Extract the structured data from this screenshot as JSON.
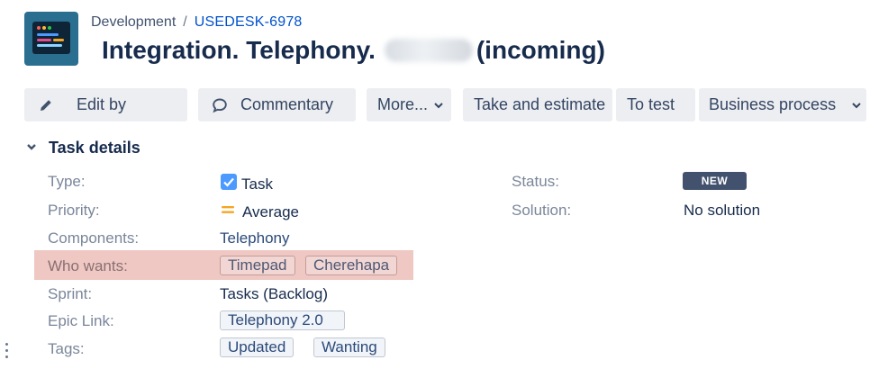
{
  "breadcrumb": {
    "project": "Development",
    "separator": "/",
    "issue_key": "USEDESK-6978"
  },
  "issue": {
    "title_prefix": "Integration. Telephony.",
    "title_suffix": "(incoming)"
  },
  "toolbar": {
    "edit_label": "Edit by",
    "comment_label": "Commentary",
    "more_label": "More...",
    "take_label": "Take and estimate",
    "test_label": "To test",
    "business_label": "Business process"
  },
  "details": {
    "section_title": "Task details",
    "type": {
      "label": "Type:",
      "value": "Task"
    },
    "priority": {
      "label": "Priority:",
      "value": "Average"
    },
    "components": {
      "label": "Components:",
      "value": "Telephony"
    },
    "who_wants": {
      "label": "Who wants:",
      "tags": [
        "Timepad",
        "Cherehapa"
      ]
    },
    "sprint": {
      "label": "Sprint:",
      "value": "Tasks (Backlog)"
    },
    "epic_link": {
      "label": "Epic Link:",
      "value": "Telephony 2.0"
    },
    "tags": {
      "label": "Tags:",
      "values": [
        "Updated",
        "Wanting"
      ]
    },
    "status": {
      "label": "Status:",
      "value": "NEW"
    },
    "solution": {
      "label": "Solution:",
      "value": "No solution"
    }
  },
  "icons": {
    "edit": "pencil-icon",
    "comment": "speech-bubble-icon",
    "dropdown": "chevron-down-icon",
    "type": "checkbox-task-icon",
    "priority": "priority-medium-icon",
    "collapse": "chevron-down-icon"
  },
  "colors": {
    "accent": "#0052cc",
    "highlight": "#efc8c3",
    "status_badge": "#42526e",
    "priority_medium": "#f5a623",
    "task_icon": "#4c9aff"
  }
}
